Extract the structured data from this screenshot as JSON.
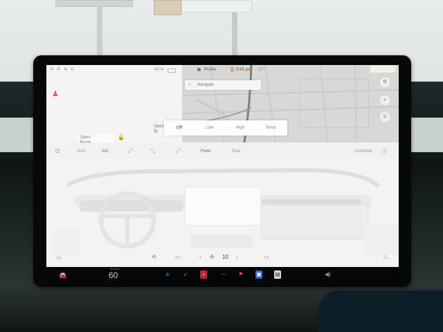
{
  "status_bar": {
    "gears": "P R N D",
    "range": "30 %",
    "profile": "Profile",
    "clock": "3:01 pm",
    "temperature": "19 °"
  },
  "car_panel": {
    "frunk_title": "Open",
    "frunk_value": "Frunk",
    "trunk_title": "Open",
    "trunk_value": "Tr"
  },
  "map": {
    "search_placeholder": "Navigate",
    "label_a": "",
    "label_b": "",
    "top_tag": ""
  },
  "defrost_popover": {
    "segments": [
      "Off",
      "Low",
      "High",
      "Temp"
    ],
    "selected_index": 0
  },
  "climate": {
    "auto_label": "Auto",
    "ac_label": "A/C",
    "front_label": "Front",
    "rear_label": "Rear",
    "schedule_label": "Schedule"
  },
  "climate_bottom": {
    "fan_speed": "10"
  },
  "dock": {
    "temp_label": "Manual",
    "temp_value": "60",
    "apps": [
      "bluetooth",
      "navigation",
      "music",
      "more",
      "toybox",
      "camera",
      "calendar"
    ]
  },
  "icons": {
    "seatbelt": "seatbelt-warning-icon",
    "lock": "lock-icon",
    "search": "search-icon",
    "power": "power-icon",
    "car": "car-icon",
    "volume": "volume-icon"
  },
  "colors": {
    "screen_bg": "#f3f3f3",
    "map_bg": "#dadada",
    "bezel": "#070808",
    "clock": "#9a7a2a",
    "seatbelt_warning": "#e06060",
    "bluetooth": "#3a8cf0",
    "music": "#c0203a"
  }
}
